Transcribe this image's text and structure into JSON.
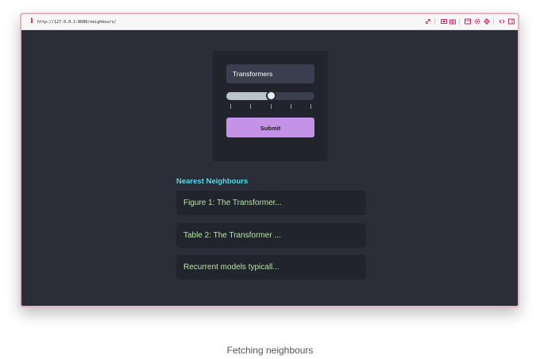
{
  "browser": {
    "url": "http://127.0.0.1:8080/neighbours/",
    "toolbar_icons": [
      "info-icon",
      "link-icon",
      "screenshot-icon",
      "camera-icon",
      "window-icon",
      "gear-icon",
      "crosshair-icon",
      "code-icon",
      "sidebar-icon"
    ]
  },
  "search": {
    "query": "Transformers",
    "slider_value_fraction": 0.5,
    "slider_ticks": 5,
    "submit_label": "Submit"
  },
  "results": {
    "title": "Nearest Neighbours",
    "items": [
      {
        "label": "Figure 1: The Transformer..."
      },
      {
        "label": "Table 2: The Transformer ..."
      },
      {
        "label": "Recurrent models typicall..."
      }
    ]
  },
  "caption": "Fetching neighbours",
  "colors": {
    "background": "#2b2e38",
    "card": "#21242c",
    "accent_button": "#c492e6",
    "title": "#5fd3e6",
    "result_text": "#b4e3a1",
    "window_border": "#e3b6c4"
  }
}
